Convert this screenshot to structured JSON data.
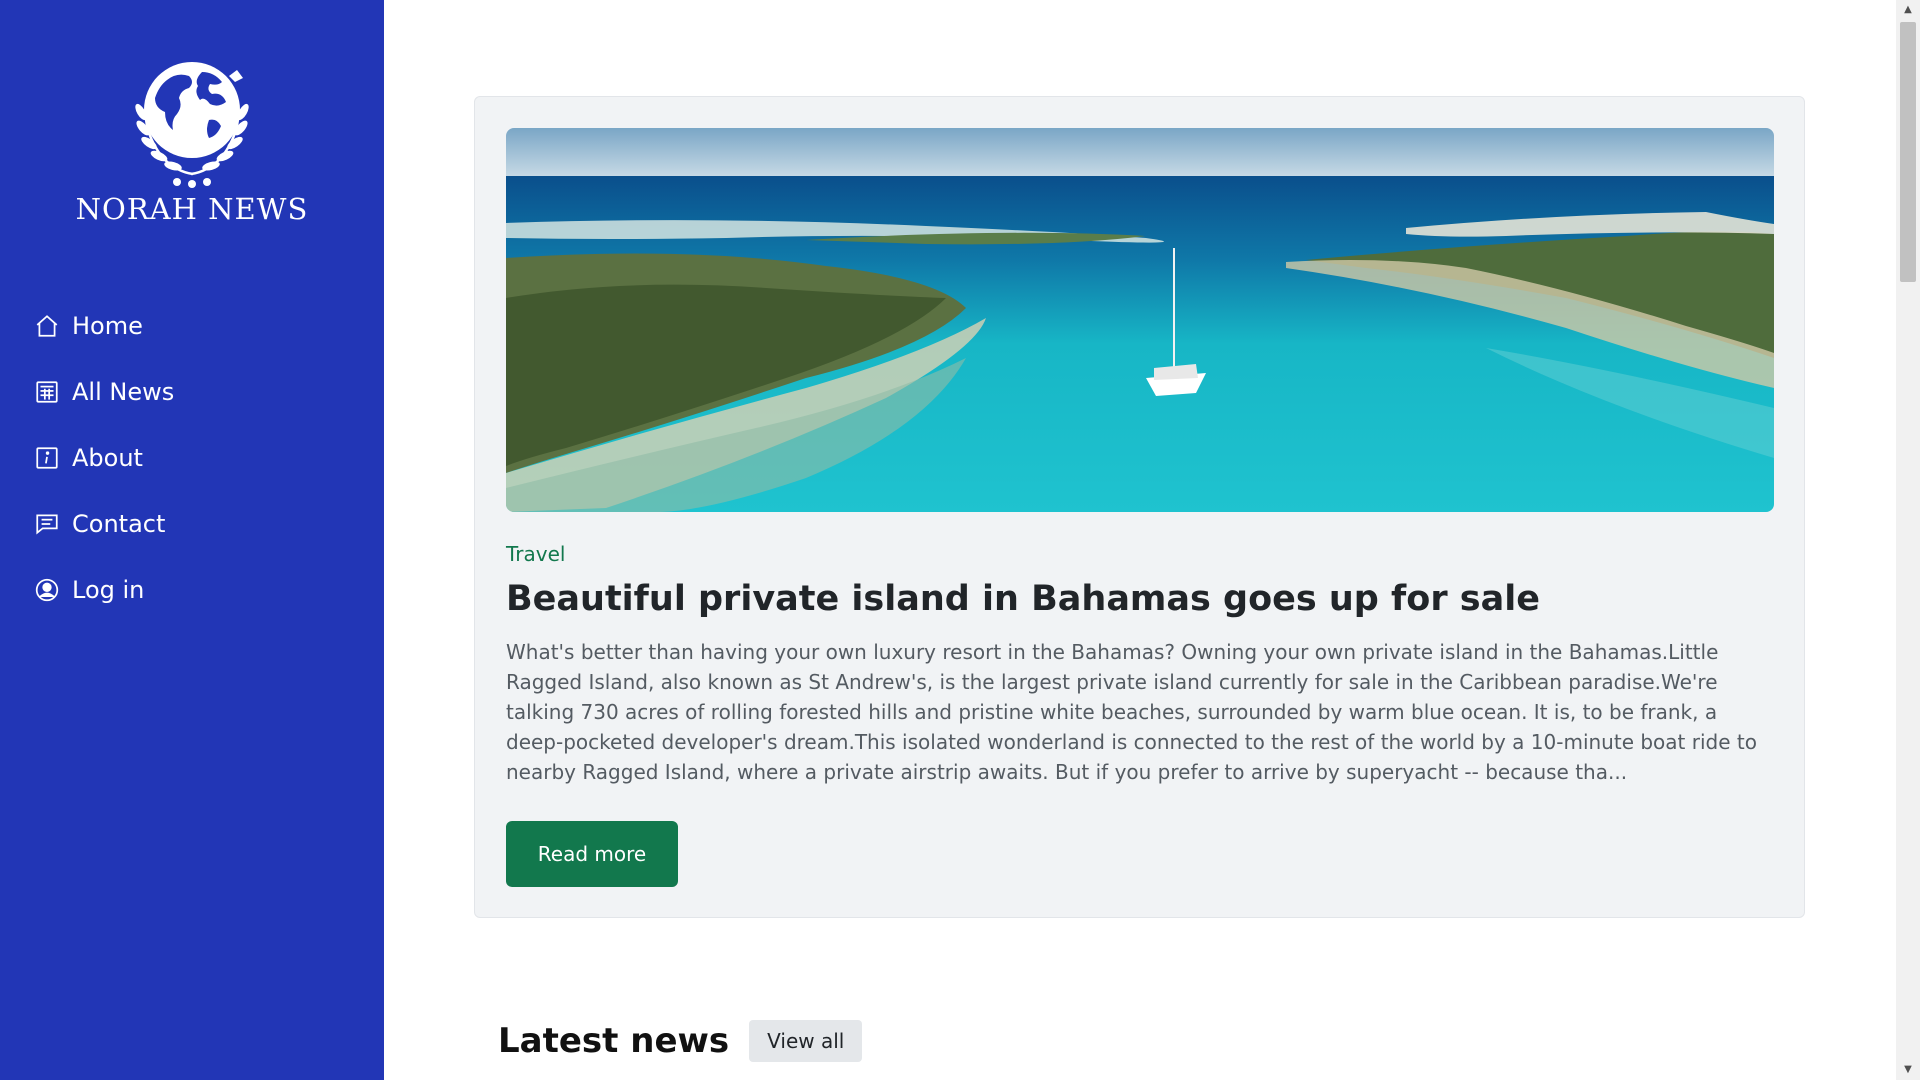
{
  "sidebar": {
    "brand": "NORAH NEWS",
    "nav": [
      {
        "label": "Home",
        "icon": "home-icon"
      },
      {
        "label": "All News",
        "icon": "newspaper-icon"
      },
      {
        "label": "About",
        "icon": "info-icon"
      },
      {
        "label": "Contact",
        "icon": "chat-icon"
      },
      {
        "label": "Log in",
        "icon": "user-circle-icon"
      }
    ]
  },
  "featured": {
    "image": "aerial-island-catamaran",
    "category": "Travel",
    "title": "Beautiful private island in Bahamas goes up for sale",
    "excerpt": "What's better than having your own luxury resort in the Bahamas? Owning your own private island in the Bahamas.Little Ragged Island, also known as St Andrew's, is the largest private island currently for sale in the Caribbean paradise.We're talking 730 acres of rolling forested hills and pristine white beaches, surrounded by warm blue ocean. It is, to be frank, a deep-pocketed developer's dream.This isolated wonderland is connected to the rest of the world by a 10-minute boat ride to nearby Ragged Island, where a private airstrip awaits. But if you prefer to arrive by superyacht -- because tha...",
    "button_label": "Read more"
  },
  "latest": {
    "title": "Latest news",
    "view_all_label": "View all"
  },
  "colors": {
    "sidebar_bg": "#2236b6",
    "accent_green": "#12784d",
    "card_bg": "#f1f3f5"
  }
}
